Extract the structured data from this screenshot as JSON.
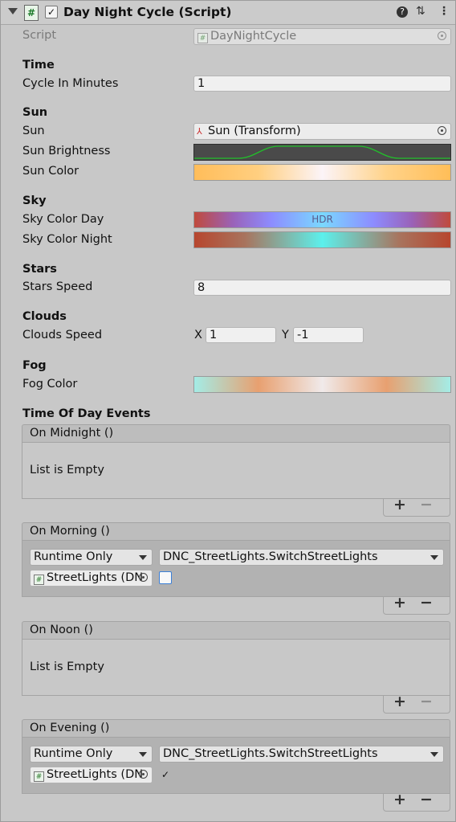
{
  "header": {
    "title": "Day Night Cycle (Script)",
    "script_icon": "#",
    "enabled_check": "✓",
    "help_icon": "?",
    "settings_icon": "⇅",
    "menu_icon": "⋮"
  },
  "script": {
    "label": "Script",
    "value": "DayNightCycle"
  },
  "time": {
    "section": "Time",
    "cycle_label": "Cycle In Minutes",
    "cycle_value": "1"
  },
  "sun": {
    "section": "Sun",
    "sun_label": "Sun",
    "sun_value": "Sun (Transform)",
    "brightness_label": "Sun Brightness",
    "color_label": "Sun Color"
  },
  "sky": {
    "section": "Sky",
    "day_label": "Sky Color Day",
    "day_hdr": "HDR",
    "night_label": "Sky Color Night"
  },
  "stars": {
    "section": "Stars",
    "speed_label": "Stars Speed",
    "speed_value": "8"
  },
  "clouds": {
    "section": "Clouds",
    "speed_label": "Clouds Speed",
    "x_label": "X",
    "x_value": "1",
    "y_label": "Y",
    "y_value": "-1"
  },
  "fog": {
    "section": "Fog",
    "color_label": "Fog Color"
  },
  "events": {
    "section": "Time Of Day Events",
    "midnight": {
      "title": "On Midnight ()",
      "empty": "List is Empty"
    },
    "morning": {
      "title": "On Morning ()",
      "mode": "Runtime Only",
      "function": "DNC_StreetLights.SwitchStreetLights",
      "target": "StreetLights (DN",
      "arg_checked": ""
    },
    "noon": {
      "title": "On Noon ()",
      "empty": "List is Empty"
    },
    "evening": {
      "title": "On Evening ()",
      "mode": "Runtime Only",
      "function": "DNC_StreetLights.SwitchStreetLights",
      "target": "StreetLights (DN",
      "arg_checked": "✓"
    },
    "plus": "+",
    "minus": "−"
  },
  "colors": {
    "curve_line": "#21c02a",
    "accent_checkbox": "#3b7fd6"
  }
}
